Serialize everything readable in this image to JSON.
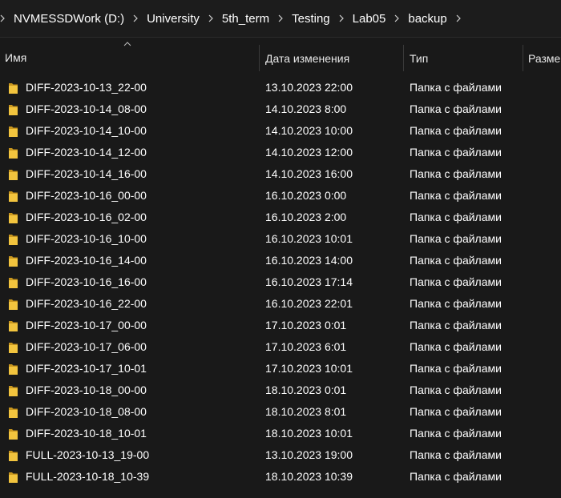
{
  "breadcrumb": {
    "items": [
      {
        "label": "NVMESSDWork (D:)"
      },
      {
        "label": "University"
      },
      {
        "label": "5th_term"
      },
      {
        "label": "Testing"
      },
      {
        "label": "Lab05"
      },
      {
        "label": "backup"
      }
    ]
  },
  "columns": {
    "name": "Имя",
    "date": "Дата изменения",
    "type": "Тип",
    "size": "Разме"
  },
  "sort": {
    "column": "name",
    "direction": "ascending"
  },
  "icons": {
    "folder": "folder-icon",
    "separator": "chevron-right-icon",
    "sort": "sort-up-icon"
  },
  "colors": {
    "background": "#191919",
    "folder": "#f2c43e",
    "text": "#ffffff"
  },
  "files": [
    {
      "name": "DIFF-2023-10-13_22-00",
      "date": "13.10.2023 22:00",
      "type": "Папка с файлами"
    },
    {
      "name": "DIFF-2023-10-14_08-00",
      "date": "14.10.2023 8:00",
      "type": "Папка с файлами"
    },
    {
      "name": "DIFF-2023-10-14_10-00",
      "date": "14.10.2023 10:00",
      "type": "Папка с файлами"
    },
    {
      "name": "DIFF-2023-10-14_12-00",
      "date": "14.10.2023 12:00",
      "type": "Папка с файлами"
    },
    {
      "name": "DIFF-2023-10-14_16-00",
      "date": "14.10.2023 16:00",
      "type": "Папка с файлами"
    },
    {
      "name": "DIFF-2023-10-16_00-00",
      "date": "16.10.2023 0:00",
      "type": "Папка с файлами"
    },
    {
      "name": "DIFF-2023-10-16_02-00",
      "date": "16.10.2023 2:00",
      "type": "Папка с файлами"
    },
    {
      "name": "DIFF-2023-10-16_10-00",
      "date": "16.10.2023 10:01",
      "type": "Папка с файлами"
    },
    {
      "name": "DIFF-2023-10-16_14-00",
      "date": "16.10.2023 14:00",
      "type": "Папка с файлами"
    },
    {
      "name": "DIFF-2023-10-16_16-00",
      "date": "16.10.2023 17:14",
      "type": "Папка с файлами"
    },
    {
      "name": "DIFF-2023-10-16_22-00",
      "date": "16.10.2023 22:01",
      "type": "Папка с файлами"
    },
    {
      "name": "DIFF-2023-10-17_00-00",
      "date": "17.10.2023 0:01",
      "type": "Папка с файлами"
    },
    {
      "name": "DIFF-2023-10-17_06-00",
      "date": "17.10.2023 6:01",
      "type": "Папка с файлами"
    },
    {
      "name": "DIFF-2023-10-17_10-01",
      "date": "17.10.2023 10:01",
      "type": "Папка с файлами"
    },
    {
      "name": "DIFF-2023-10-18_00-00",
      "date": "18.10.2023 0:01",
      "type": "Папка с файлами"
    },
    {
      "name": "DIFF-2023-10-18_08-00",
      "date": "18.10.2023 8:01",
      "type": "Папка с файлами"
    },
    {
      "name": "DIFF-2023-10-18_10-01",
      "date": "18.10.2023 10:01",
      "type": "Папка с файлами"
    },
    {
      "name": "FULL-2023-10-13_19-00",
      "date": "13.10.2023 19:00",
      "type": "Папка с файлами"
    },
    {
      "name": "FULL-2023-10-18_10-39",
      "date": "18.10.2023 10:39",
      "type": "Папка с файлами"
    }
  ]
}
